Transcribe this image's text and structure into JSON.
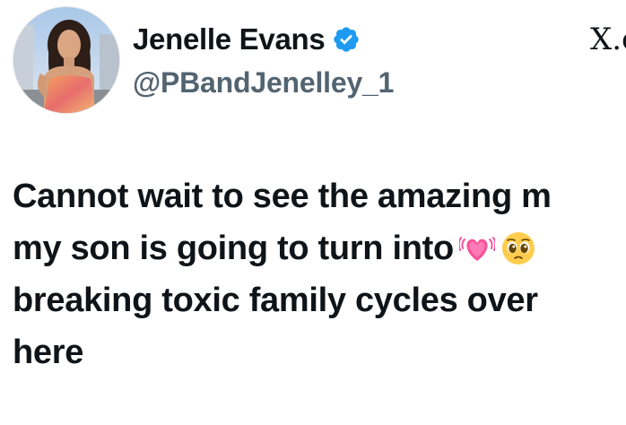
{
  "tweet": {
    "author": {
      "display_name": "Jenelle Evans",
      "handle": "@PBandJenelley_1",
      "verified": true,
      "avatar_icon": "profile-photo"
    },
    "platform_logo": "X.c",
    "text_lines": [
      "Cannot wait to see the amazing m",
      "my son is going to turn into",
      "breaking toxic family cycles over",
      "here"
    ],
    "emojis": [
      "growing-heart-icon",
      "pleading-face-icon"
    ],
    "colors": {
      "text": "#0f1419",
      "handle": "#536471",
      "verified_badge": "#1d9bf0",
      "heart": "#f7539b",
      "face": "#ffcc4d"
    }
  }
}
